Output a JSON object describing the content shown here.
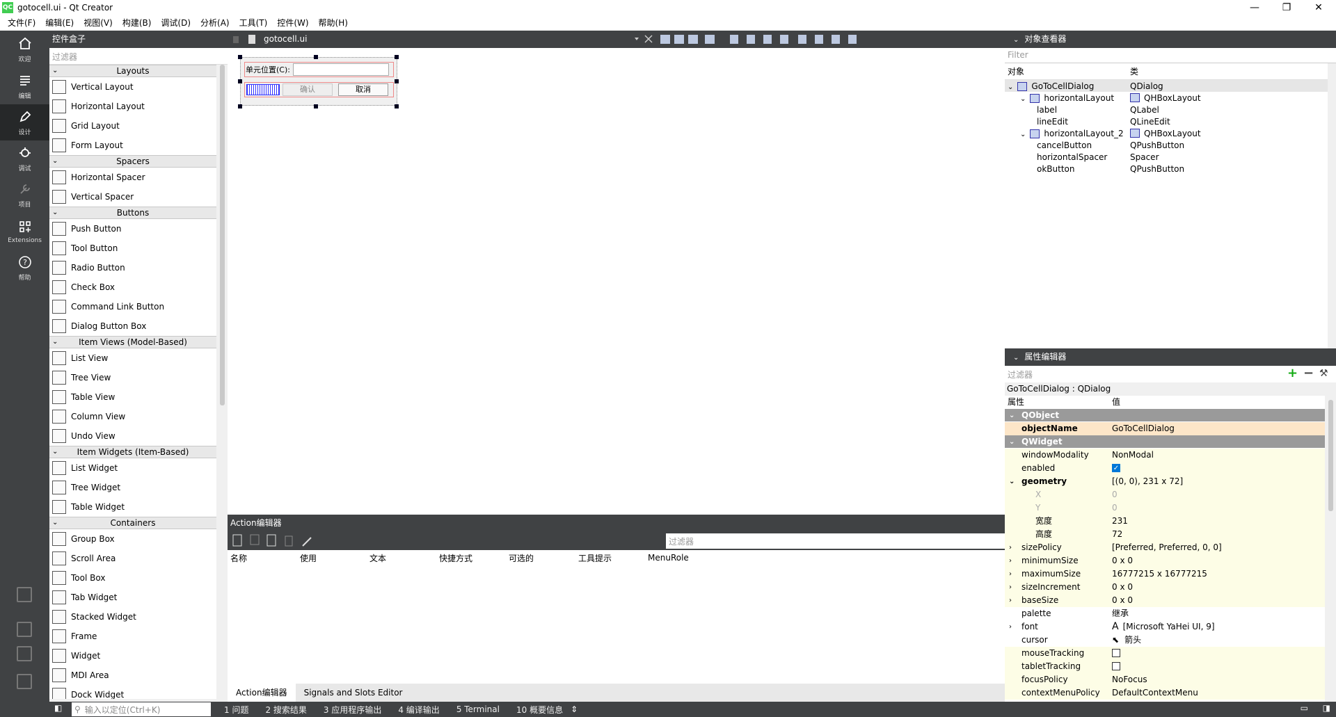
{
  "title": "gotocell.ui - Qt Creator",
  "app_icon": "QC",
  "menus": [
    "文件(F)",
    "编辑(E)",
    "视图(V)",
    "构建(B)",
    "调试(D)",
    "分析(A)",
    "工具(T)",
    "控件(W)",
    "帮助(H)"
  ],
  "modes": [
    {
      "label": "欢迎",
      "icon": "home-icon"
    },
    {
      "label": "编辑",
      "icon": "edit-icon"
    },
    {
      "label": "设计",
      "icon": "design-icon"
    },
    {
      "label": "调试",
      "icon": "debug-icon"
    },
    {
      "label": "项目",
      "icon": "wrench-icon"
    },
    {
      "label": "Extensions",
      "icon": "extensions-icon"
    },
    {
      "label": "帮助",
      "icon": "help-icon"
    }
  ],
  "widget_box": {
    "title": "控件盒子",
    "filter_placeholder": "过滤器",
    "categories": [
      {
        "name": "Layouts",
        "items": [
          "Vertical Layout",
          "Horizontal Layout",
          "Grid Layout",
          "Form Layout"
        ]
      },
      {
        "name": "Spacers",
        "items": [
          "Horizontal Spacer",
          "Vertical Spacer"
        ]
      },
      {
        "name": "Buttons",
        "items": [
          "Push Button",
          "Tool Button",
          "Radio Button",
          "Check Box",
          "Command Link Button",
          "Dialog Button Box"
        ]
      },
      {
        "name": "Item Views (Model-Based)",
        "items": [
          "List View",
          "Tree View",
          "Table View",
          "Column View",
          "Undo View"
        ]
      },
      {
        "name": "Item Widgets (Item-Based)",
        "items": [
          "List Widget",
          "Tree Widget",
          "Table Widget"
        ]
      },
      {
        "name": "Containers",
        "items": [
          "Group Box",
          "Scroll Area",
          "Tool Box",
          "Tab Widget",
          "Stacked Widget",
          "Frame",
          "Widget",
          "MDI Area",
          "Dock Widget"
        ]
      }
    ]
  },
  "editor": {
    "file_tab": "gotocell.ui",
    "form": {
      "label": "单元位置(C):",
      "ok": "确认",
      "cancel": "取消"
    }
  },
  "action_editor": {
    "title": "Action编辑器",
    "filter_placeholder": "过滤器",
    "columns": [
      "名称",
      "使用",
      "文本",
      "快捷方式",
      "可选的",
      "工具提示",
      "MenuRole"
    ],
    "tabs": [
      "Action编辑器",
      "Signals and Slots Editor"
    ]
  },
  "object_inspector": {
    "title": "对象查看器",
    "filter_placeholder": "Filter",
    "col_object": "对象",
    "col_class": "类",
    "rows": [
      {
        "name": "GoToCellDialog",
        "cls": "QDialog",
        "level": 0,
        "expand": true,
        "icon": true,
        "selected": true
      },
      {
        "name": "horizontalLayout",
        "cls": "QHBoxLayout",
        "level": 1,
        "expand": true,
        "icon": true
      },
      {
        "name": "label",
        "cls": "QLabel",
        "level": 2
      },
      {
        "name": "lineEdit",
        "cls": "QLineEdit",
        "level": 2
      },
      {
        "name": "horizontalLayout_2",
        "cls": "QHBoxLayout",
        "level": 1,
        "expand": true,
        "icon": true
      },
      {
        "name": "cancelButton",
        "cls": "QPushButton",
        "level": 2
      },
      {
        "name": "horizontalSpacer",
        "cls": "Spacer",
        "level": 2
      },
      {
        "name": "okButton",
        "cls": "QPushButton",
        "level": 2
      }
    ]
  },
  "property_editor": {
    "title": "属性编辑器",
    "filter_placeholder": "过滤器",
    "class_line": "GoToCellDialog : QDialog",
    "col_prop": "属性",
    "col_value": "值",
    "rows": [
      {
        "type": "group",
        "name": "QObject"
      },
      {
        "name": "objectName",
        "value": "GoToCellDialog",
        "style": "orange",
        "bold": true
      },
      {
        "type": "group",
        "name": "QWidget"
      },
      {
        "name": "windowModality",
        "value": "NonModal",
        "style": "yellow"
      },
      {
        "name": "enabled",
        "value": "",
        "check": "on",
        "style": "yellow"
      },
      {
        "name": "geometry",
        "value": "[(0, 0), 231 x 72]",
        "style": "yellow",
        "bold": true,
        "expand": "open"
      },
      {
        "name": "X",
        "value": "0",
        "style": "yellow",
        "sub": true,
        "dis": true
      },
      {
        "name": "Y",
        "value": "0",
        "style": "yellow",
        "sub": true,
        "dis": true
      },
      {
        "name": "宽度",
        "value": "231",
        "style": "yellow",
        "sub": true
      },
      {
        "name": "高度",
        "value": "72",
        "style": "yellow",
        "sub": true
      },
      {
        "name": "sizePolicy",
        "value": "[Preferred, Preferred, 0, 0]",
        "style": "yellow",
        "expand": "closed"
      },
      {
        "name": "minimumSize",
        "value": "0 x 0",
        "style": "yellow",
        "expand": "closed"
      },
      {
        "name": "maximumSize",
        "value": "16777215 x 16777215",
        "style": "yellow",
        "expand": "closed"
      },
      {
        "name": "sizeIncrement",
        "value": "0 x 0",
        "style": "yellow",
        "expand": "closed"
      },
      {
        "name": "baseSize",
        "value": "0 x 0",
        "style": "yellow",
        "expand": "closed"
      },
      {
        "name": "palette",
        "value": "继承",
        "style": "white"
      },
      {
        "name": "font",
        "value": "[Microsoft YaHei UI, 9]",
        "style": "white",
        "expand": "closed",
        "prefix": "A"
      },
      {
        "name": "cursor",
        "value": "箭头",
        "style": "white",
        "prefix": "cursor"
      },
      {
        "name": "mouseTracking",
        "value": "",
        "check": "off",
        "style": "yellow"
      },
      {
        "name": "tabletTracking",
        "value": "",
        "check": "off",
        "style": "yellow"
      },
      {
        "name": "focusPolicy",
        "value": "NoFocus",
        "style": "yellow"
      },
      {
        "name": "contextMenuPolicy",
        "value": "DefaultContextMenu",
        "style": "yellow"
      }
    ]
  },
  "statusbar": {
    "locator_placeholder": "输入以定位(Ctrl+K)",
    "outputs": [
      "1 问题",
      "2 搜索结果",
      "3 应用程序输出",
      "4 编译输出",
      "5 Terminal",
      "10 概要信息"
    ]
  }
}
